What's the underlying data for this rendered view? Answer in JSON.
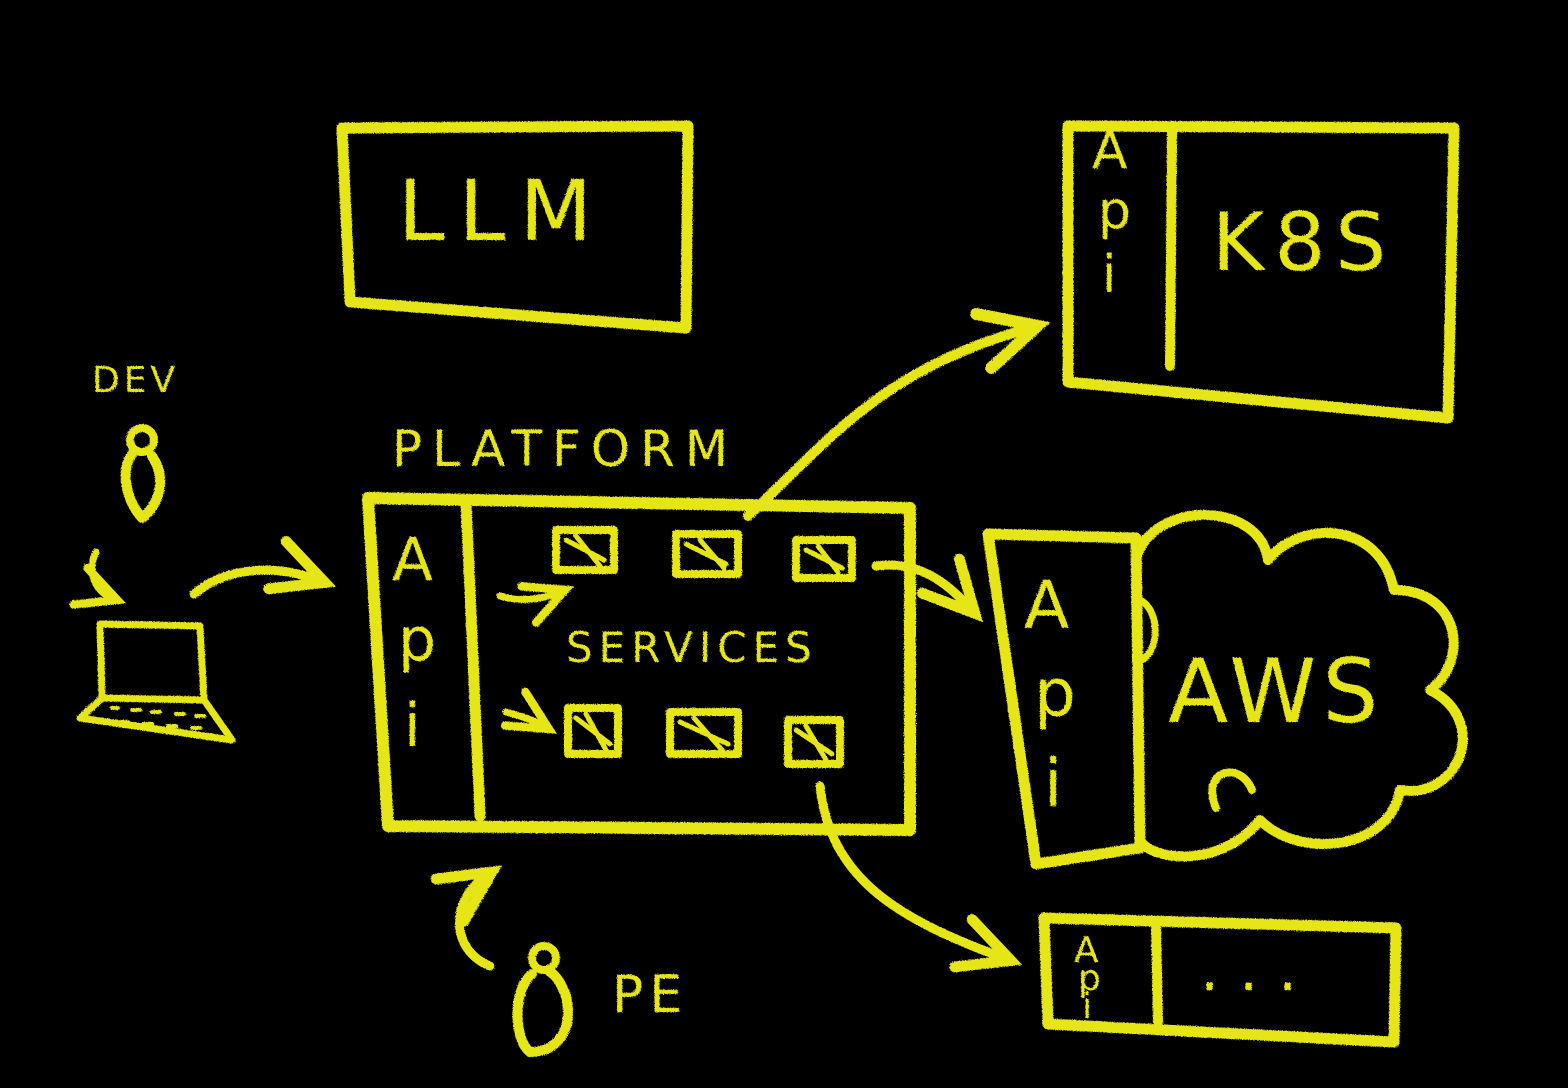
{
  "colors": {
    "background": "#000000",
    "chalk": "#e6e614",
    "chalk_dim": "#cfcf12"
  },
  "labels": {
    "llm": "LLM",
    "k8s": "K8S",
    "aws": "AWS",
    "ellipsis": "...",
    "platform": "PLATFORM",
    "services": "SERVICES",
    "dev": "DEV",
    "pe": "PE",
    "api_k8s": "Api",
    "api_platform": "Api",
    "api_aws": "Api",
    "api_other": "Api"
  },
  "icons": {
    "dev_person": "person-icon",
    "pe_person": "person-icon",
    "laptop": "laptop-icon",
    "service": "service-box-icon"
  }
}
